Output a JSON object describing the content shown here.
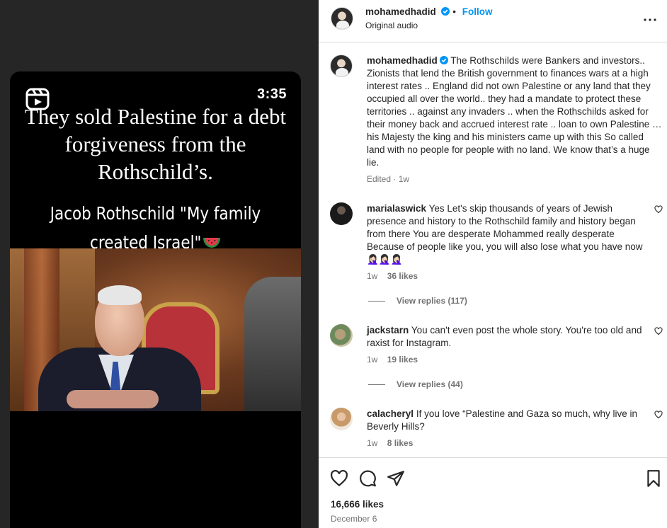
{
  "reel": {
    "duration": "3:35",
    "headline": "They sold Palestine for a debt forgiveness from the Rothschild’s.",
    "quote": "Jacob Rothschild \"My family created Israel\""
  },
  "post": {
    "username": "mohamedhadid",
    "follow_label": "Follow",
    "separator": "•",
    "audio": "Original audio",
    "caption": "The Rothschilds were Bankers and investors.. Zionists that lend the British government to finances wars at a high interest rates .. England did not own Palestine or any land that they occupied all over the world.. they had a mandate to protect these territories .. against any invaders .. when the Rothschilds asked for their money back and accrued interest rate .. loan to own Palestine … his Majesty the king and his ministers came up with this So called land with no people for people with no land. We know that’s a huge lie.",
    "caption_meta": "Edited · 1w",
    "likes": "16,666 likes",
    "date": "December 6"
  },
  "comments": [
    {
      "username": "marialaswick",
      "text": "Yes Let's skip thousands of years of Jewish presence and history to the Rothschild family and history began from there You are desperate Mohammed really desperate Because of people like you, you will also lose what you have now🤦🏻‍♀️🤦🏻‍♀️🤦🏻‍♀️",
      "time": "1w",
      "likes": "36 likes",
      "replies": "View replies (117)"
    },
    {
      "username": "jackstarn",
      "text": "You can't even post the whole story. You're too old and raxist for Instagram.",
      "time": "1w",
      "likes": "19 likes",
      "replies": "View replies (44)"
    },
    {
      "username": "calacheryl",
      "text": "If you love “Palestine and Gaza so much, why live in Beverly Hills?",
      "time": "1w",
      "likes": "8 likes"
    }
  ],
  "icons": {
    "reel": "reels-icon",
    "verified": "verified-badge-icon",
    "more": "more-options-icon",
    "like": "heart-icon",
    "comment": "comment-icon",
    "share": "share-icon",
    "save": "bookmark-icon"
  },
  "colors": {
    "link": "#0095f6",
    "verified": "#0095f6",
    "secondary_text": "#737373",
    "backdrop": "#262626"
  }
}
